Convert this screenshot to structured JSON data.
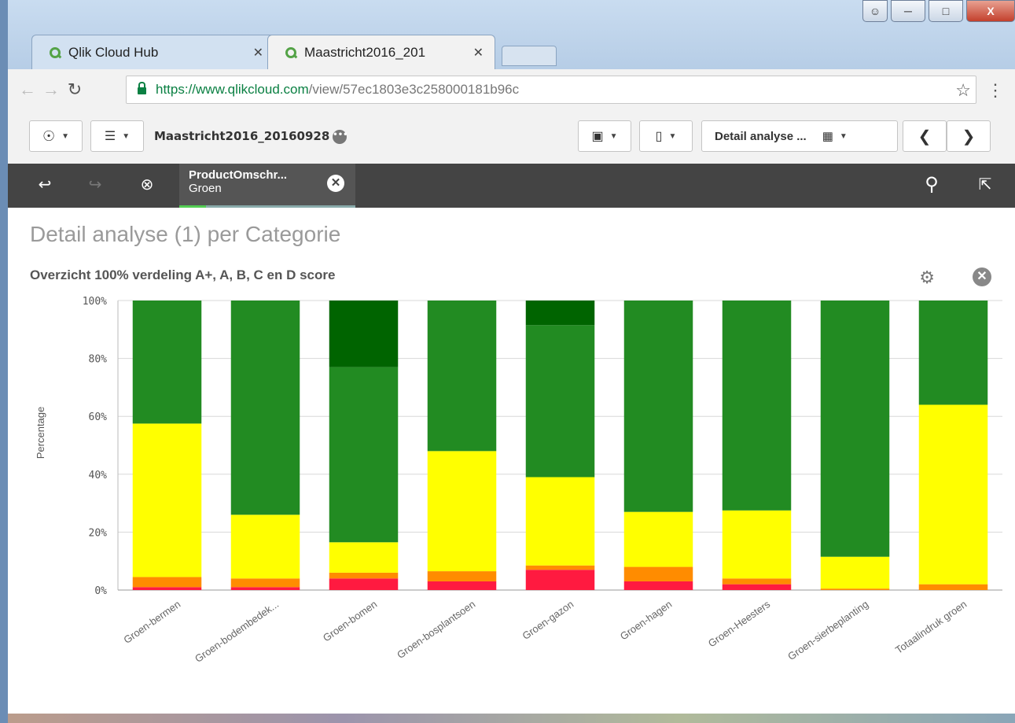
{
  "browser": {
    "tabs": [
      {
        "label": "Qlik Cloud Hub",
        "active": false
      },
      {
        "label": "Maastricht2016_201",
        "active": true
      }
    ],
    "url_host": "https://www.qlikcloud.com",
    "url_path": "/view/57ec1803e3c258000181b96c"
  },
  "toolbar": {
    "app_title": "Maastricht2016_20160928",
    "sheet_button_label": "Detail analyse ..."
  },
  "selections": {
    "field": "ProductOmschr...",
    "value": "Groen"
  },
  "sheet": {
    "title": "Detail analyse (1) per Categorie"
  },
  "chart_data": {
    "type": "bar",
    "stacked": true,
    "title": "Overzicht 100% verdeling A+, A, B, C en D score",
    "ylabel": "Percentage",
    "xlabel": "",
    "ylim": [
      0,
      100
    ],
    "yticks": [
      "0%",
      "20%",
      "40%",
      "60%",
      "80%",
      "100%"
    ],
    "grid": true,
    "categories": [
      "Groen-bermen",
      "Groen-bodembedek...",
      "Groen-bomen",
      "Groen-bosplantsoen",
      "Groen-gazon",
      "Groen-hagen",
      "Groen-Heesters",
      "Groen-sierbeplanting",
      "Totaalindruk groen"
    ],
    "series": [
      {
        "color": "#ff1a40",
        "values": [
          1,
          1,
          4,
          3,
          7,
          3,
          2,
          0,
          0
        ]
      },
      {
        "color": "#ff8c00",
        "values": [
          3.5,
          3,
          2,
          3.5,
          1.5,
          5,
          2,
          0.5,
          2
        ]
      },
      {
        "color": "#ffff00",
        "values": [
          53,
          22,
          10.5,
          41.5,
          30.5,
          19,
          23.5,
          11,
          62
        ]
      },
      {
        "color": "#228b22",
        "values": [
          42.5,
          74,
          60.5,
          52,
          52.5,
          73,
          72.5,
          88.5,
          36
        ]
      },
      {
        "color": "#006400",
        "values": [
          0,
          0,
          23,
          0,
          8.5,
          0,
          0,
          0,
          0
        ]
      }
    ]
  }
}
